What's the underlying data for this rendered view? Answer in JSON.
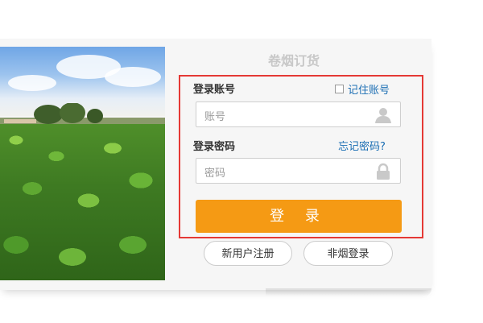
{
  "header": {
    "title": "卷烟订货"
  },
  "login": {
    "account_label": "登录账号",
    "remember_label": "记住账号",
    "account_placeholder": "账号",
    "password_label": "登录密码",
    "forgot_label": "忘记密码?",
    "password_placeholder": "密码",
    "login_button": "登 录"
  },
  "actions": {
    "register_label": "新用户注册",
    "non_tobacco_label": "非烟登录"
  },
  "colors": {
    "accent": "#f59a14",
    "highlight_border": "#e53935",
    "link": "#1a6db3"
  },
  "icons": {
    "account_icon": "user-icon",
    "password_icon": "lock-icon"
  }
}
